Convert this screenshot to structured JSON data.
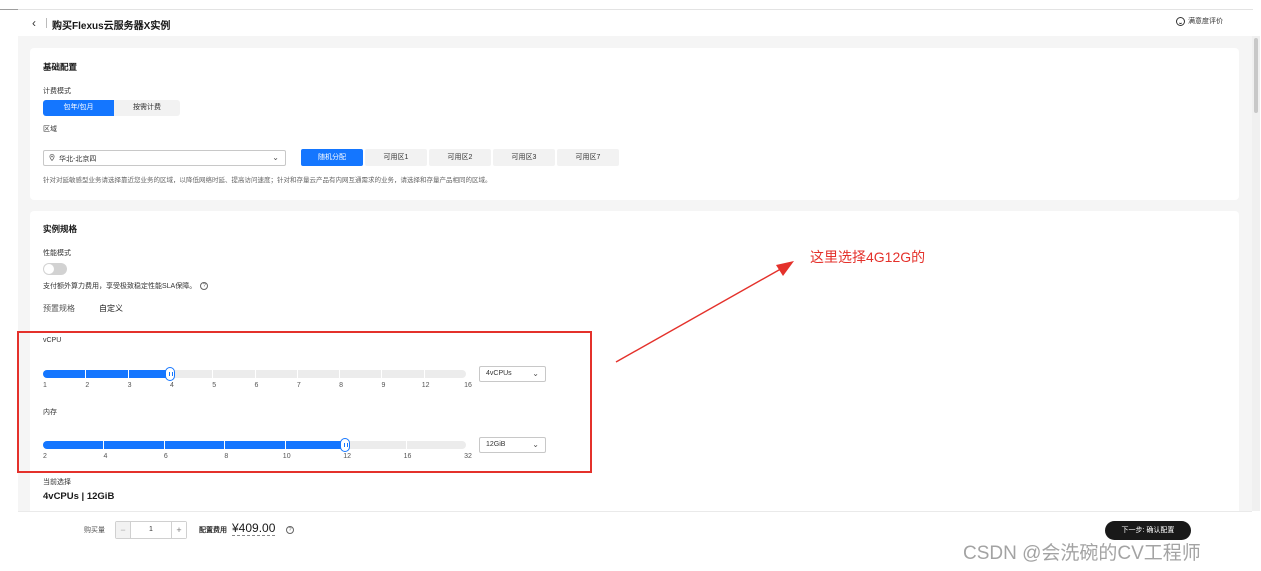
{
  "header": {
    "back_icon": "chevron-left-icon",
    "title": "购买Flexus云服务器X实例",
    "survey_label": "满意度评价"
  },
  "basic_config": {
    "section_title": "基础配置",
    "billing_label": "计费模式",
    "billing_options": [
      "包年/包月",
      "按需计费"
    ],
    "billing_selected": "包年/包月",
    "region_label": "区域",
    "region_value": "华北-北京四",
    "zones": [
      "随机分配",
      "可用区1",
      "可用区2",
      "可用区3",
      "可用区7"
    ],
    "zone_selected": "随机分配",
    "region_hint": "针对对延敏感型业务请选择靠近您业务的区域，以降低网络时延、提高访问速度；针对和存量云产品有内网互通需求的业务，请选择和存量产品相同的区域。"
  },
  "instance_spec": {
    "section_title": "实例规格",
    "perf_label": "性能模式",
    "perf_enabled": false,
    "perf_desc": "支付额外算力费用，享受极致稳定性能SLA保障。",
    "tabs": [
      "预置规格",
      "自定义"
    ],
    "tab_selected": "自定义",
    "vcpu": {
      "label": "vCPU",
      "ticks": [
        "1",
        "2",
        "3",
        "4",
        "5",
        "6",
        "7",
        "8",
        "9",
        "12",
        "16"
      ],
      "selected_index": 3,
      "dropdown_value": "4vCPUs"
    },
    "memory": {
      "label": "内存",
      "ticks": [
        "2",
        "4",
        "6",
        "8",
        "10",
        "12",
        "16",
        "32"
      ],
      "selected_index": 5,
      "dropdown_value": "12GiB"
    },
    "current_label": "当前选择",
    "current_value": "4vCPUs | 12GiB"
  },
  "footer": {
    "qty_label": "购买量",
    "qty_value": "1",
    "minus": "−",
    "plus": "+",
    "price_label": "配置费用",
    "price_value": "¥409.00",
    "next_button": "下一步: 确认配置"
  },
  "annotation": {
    "text": "这里选择4G12G的",
    "color": "#e4312b"
  },
  "watermark": "CSDN @会洗碗的CV工程师",
  "colors": {
    "accent": "#1476ff",
    "dark_button": "#191919"
  }
}
